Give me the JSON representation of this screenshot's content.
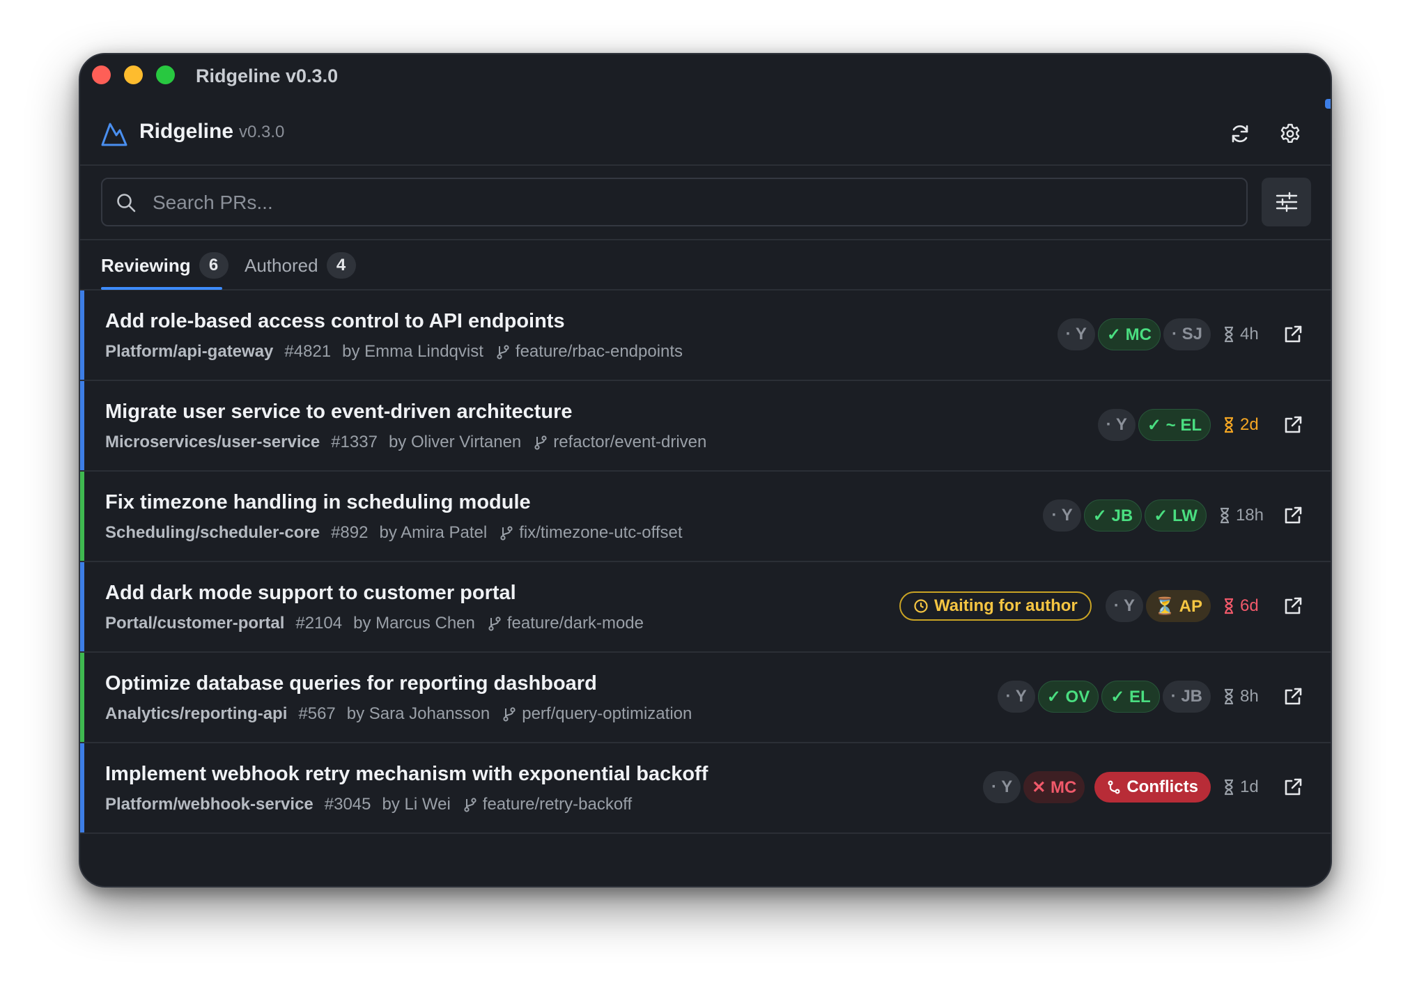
{
  "window": {
    "title": "Ridgeline v0.3.0"
  },
  "header": {
    "app_name": "Ridgeline",
    "version": "v0.3.0",
    "refresh_icon": "refresh-icon",
    "settings_icon": "gear-icon"
  },
  "search": {
    "placeholder": "Search PRs...",
    "value": "",
    "filter_icon": "sliders-icon"
  },
  "tabs": [
    {
      "label": "Reviewing",
      "count": "6",
      "active": true
    },
    {
      "label": "Authored",
      "count": "4",
      "active": false
    }
  ],
  "colors": {
    "accent": "#3d8bfd",
    "approved": "#4ade80",
    "warning": "#f5a623",
    "danger": "#f0596a",
    "waiting": "#f5c542"
  },
  "prs": [
    {
      "title": "Add role-based access control to API endpoints",
      "repo": "Platform/api-gateway",
      "number": "#4821",
      "author": "by Emma Lindqvist",
      "branch": "feature/rbac-endpoints",
      "accent": "#3d7ee6",
      "reviewers": [
        {
          "text": "· Y",
          "state": "pending"
        },
        {
          "text": "✓ MC",
          "state": "approved"
        },
        {
          "text": "· SJ",
          "state": "pending"
        }
      ],
      "age": "4h",
      "age_state": "normal"
    },
    {
      "title": "Migrate user service to event-driven architecture",
      "repo": "Microservices/user-service",
      "number": "#1337",
      "author": "by Oliver Virtanen",
      "branch": "refactor/event-driven",
      "accent": "#3d7ee6",
      "reviewers": [
        {
          "text": "· Y",
          "state": "pending"
        },
        {
          "text": "✓ ~ EL",
          "state": "approved"
        }
      ],
      "age": "2d",
      "age_state": "warning"
    },
    {
      "title": "Fix timezone handling in scheduling module",
      "repo": "Scheduling/scheduler-core",
      "number": "#892",
      "author": "by Amira Patel",
      "branch": "fix/timezone-utc-offset",
      "accent": "#3fb950",
      "reviewers": [
        {
          "text": "· Y",
          "state": "pending"
        },
        {
          "text": "✓ JB",
          "state": "approved"
        },
        {
          "text": "✓ LW",
          "state": "approved"
        }
      ],
      "age": "18h",
      "age_state": "normal"
    },
    {
      "title": "Add dark mode support to customer portal",
      "repo": "Portal/customer-portal",
      "number": "#2104",
      "author": "by Marcus Chen",
      "branch": "feature/dark-mode",
      "accent": "#3d7ee6",
      "status_badge": "Waiting for author",
      "reviewers": [
        {
          "text": "· Y",
          "state": "pending"
        },
        {
          "text": "⏳ AP",
          "state": "waiting"
        }
      ],
      "age": "6d",
      "age_state": "danger"
    },
    {
      "title": "Optimize database queries for reporting dashboard",
      "repo": "Analytics/reporting-api",
      "number": "#567",
      "author": "by Sara Johansson",
      "branch": "perf/query-optimization",
      "accent": "#3fb950",
      "reviewers": [
        {
          "text": "· Y",
          "state": "pending"
        },
        {
          "text": "✓ OV",
          "state": "approved"
        },
        {
          "text": "✓ EL",
          "state": "approved"
        },
        {
          "text": "· JB",
          "state": "pending"
        }
      ],
      "age": "8h",
      "age_state": "normal"
    },
    {
      "title": "Implement webhook retry mechanism with exponential backoff",
      "repo": "Platform/webhook-service",
      "number": "#3045",
      "author": "by Li Wei",
      "branch": "feature/retry-backoff",
      "accent": "#3d7ee6",
      "reviewers": [
        {
          "text": "· Y",
          "state": "pending"
        },
        {
          "text": "✕ MC",
          "state": "rejected"
        }
      ],
      "conflict_badge": "Conflicts",
      "age": "1d",
      "age_state": "normal"
    }
  ]
}
